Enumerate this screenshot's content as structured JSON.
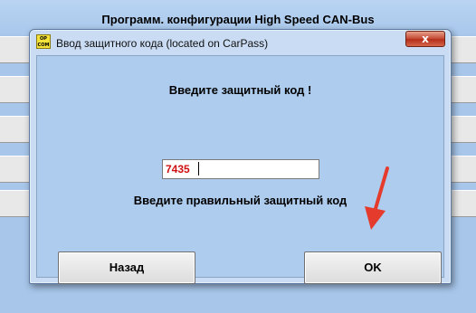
{
  "background_window": {
    "title": "Программ. конфигурации High Speed CAN-Bus"
  },
  "dialog": {
    "app_icon_text": "OP COM",
    "title": "Ввод защитного кода (located on CarPass)",
    "close_label": "x",
    "prompt": "Введите защитный код !",
    "code_value": "7435",
    "hint": "Введите правильный защитный код",
    "back_label": "Назад",
    "ok_label": "OK"
  },
  "colors": {
    "annotation_arrow": "#e53b2c",
    "code_text": "#d01010"
  }
}
